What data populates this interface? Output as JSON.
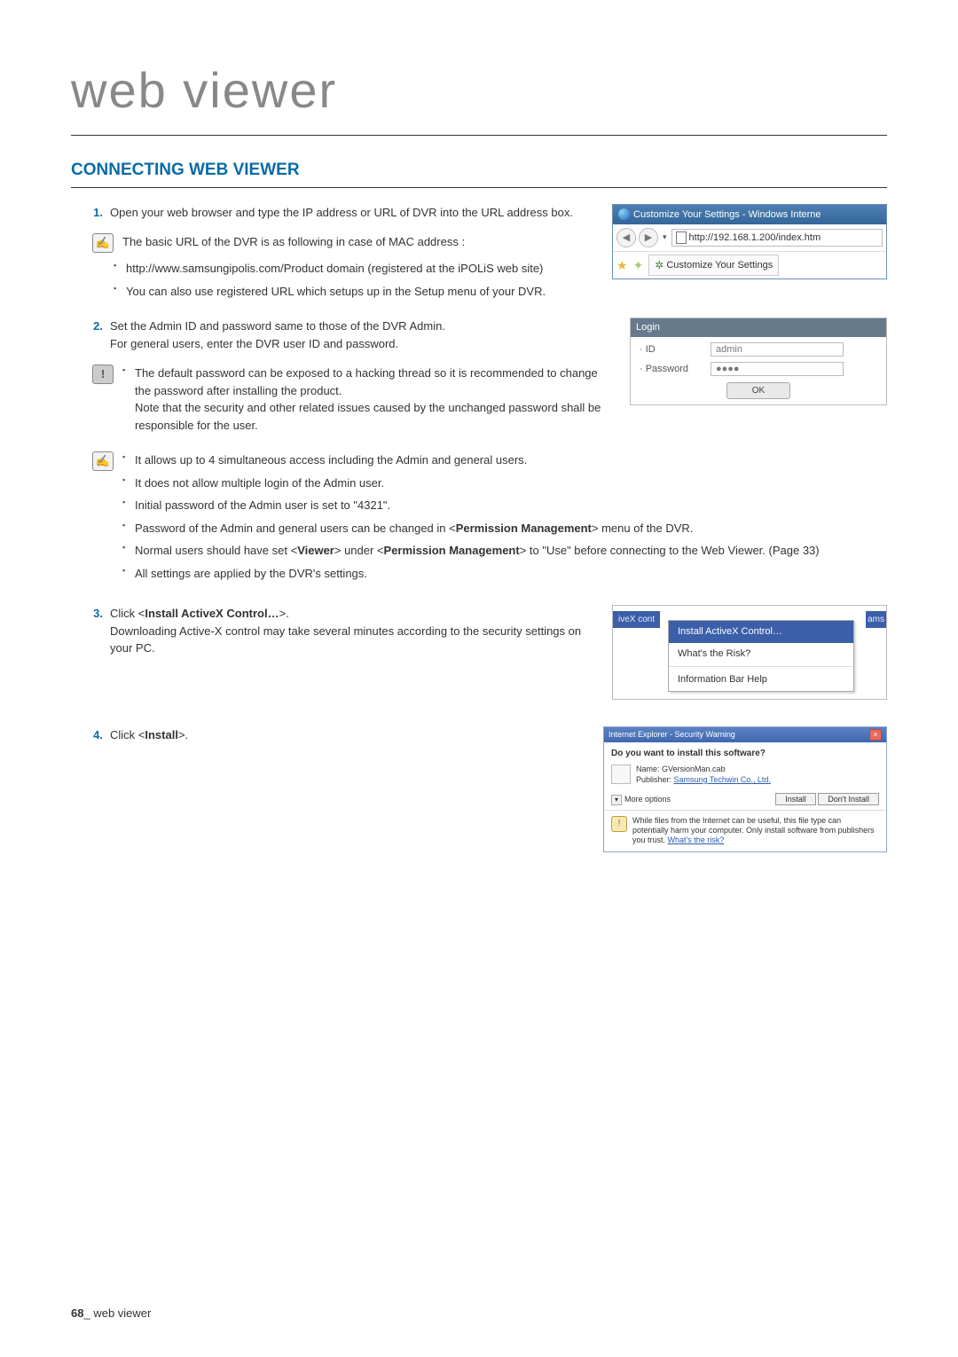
{
  "page_title": "web viewer",
  "section_heading": "CONNECTING WEB VIEWER",
  "step1": {
    "num": "1.",
    "text": "Open your web browser and type the IP address or URL of DVR into the URL address box."
  },
  "note1": {
    "intro": "The basic URL of the DVR is as following in case of MAC address :",
    "items": [
      "http://www.samsungipolis.com/Product domain (registered at the iPOLiS web site)",
      "You can also use registered URL which setups up in the Setup menu of your DVR."
    ]
  },
  "browser": {
    "title": "Customize Your Settings - Windows Interne",
    "url": "http://192.168.1.200/index.htm",
    "tab": "Customize Your Settings"
  },
  "step2": {
    "num": "2.",
    "line1": "Set the Admin ID and password same to those of the DVR Admin.",
    "line2": "For general users, enter the DVR user ID and password."
  },
  "warn2": {
    "text": "The default password can be exposed to a hacking thread so it is recommended to change the password after installing the product.\nNote that the security and other related issues caused by the unchanged password shall be responsible for the user."
  },
  "login": {
    "header": "Login",
    "id_label": "· ID",
    "id_value": "admin",
    "pw_label": "· Password",
    "pw_value": "●●●●",
    "ok": "OK"
  },
  "note2": {
    "items": [
      "It allows up to 4 simultaneous access including the Admin and general users.",
      "It does not allow multiple login of the Admin user.",
      "Initial password of the Admin user is set to \"4321\".",
      "Password of the Admin and general users can be changed in <Permission Management> menu of the DVR.",
      "Normal users should have set <Viewer> under <Permission Management> to \"Use\" before connecting to the Web Viewer. (Page 33)",
      "All settings are applied by the DVR's settings."
    ],
    "bold_map": {
      "3_a": "Permission Management",
      "4_a": "Viewer",
      "4_b": "Permission Management"
    }
  },
  "step3": {
    "num": "3.",
    "line1_a": "Click <",
    "line1_bold": "Install ActiveX Control…",
    "line1_b": ">.",
    "line2": "Downloading Active-X control may take several minutes according to the security settings on your PC."
  },
  "activex": {
    "behind_left": "iveX cont",
    "behind_right": "ams",
    "items": [
      "Install ActiveX Control…",
      "What's the Risk?",
      "Information Bar Help"
    ]
  },
  "step4": {
    "num": "4.",
    "text_a": "Click <",
    "text_bold": "Install",
    "text_b": ">."
  },
  "secwarn": {
    "title": "Internet Explorer - Security Warning",
    "question": "Do you want to install this software?",
    "name_label": "Name:",
    "name_value": "GVersionMan.cab",
    "publisher_label": "Publisher:",
    "publisher_value": "Samsung Techwin Co., Ltd.",
    "more_options": "More options",
    "install_btn": "Install",
    "dont_install_btn": "Don't Install",
    "warning_text": "While files from the Internet can be useful, this file type can potentially harm your computer. Only install software from publishers you trust.",
    "warning_link": "What's the risk?"
  },
  "footer": {
    "page": "68",
    "separator": "_",
    "label": "web viewer"
  }
}
